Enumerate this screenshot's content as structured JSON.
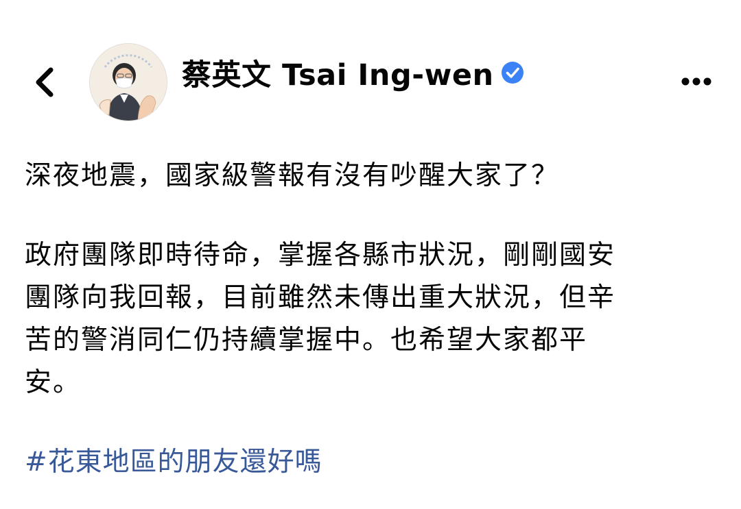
{
  "header": {
    "page_name": "蔡英文 Tsai Ing-wen",
    "back_icon": "chevron-left-icon",
    "verified_icon": "verified-badge-icon",
    "more_icon": "more-horizontal-icon",
    "verified_color": "#3b82f6"
  },
  "post": {
    "lines_para1": [
      "深夜地震，國家級警報有沒有吵醒大家了？"
    ],
    "lines_para2": [
      "政府團隊即時待命，掌握各縣市狀況，剛剛國安",
      "團隊向我回報，目前雖然未傳出重大狀況，但辛",
      "苦的警消同仁仍持續掌握中。也希望大家都平",
      "安。"
    ],
    "hashtag": "#花東地區的朋友還好嗎",
    "hashtag_color": "#385898"
  }
}
